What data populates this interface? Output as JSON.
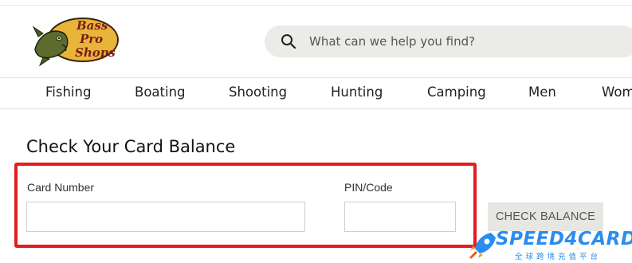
{
  "logo": {
    "text_line1": "Bass",
    "text_line2": "Pro",
    "text_line3": "Shops",
    "icon": "bass-fish-logo",
    "colors": {
      "oval": "#e9b43a",
      "text": "#7a1f16",
      "fish": "#5d6b2e"
    }
  },
  "search": {
    "placeholder": "What can we help you find?",
    "icon": "search-icon",
    "value": ""
  },
  "nav": {
    "items": [
      {
        "label": "Fishing"
      },
      {
        "label": "Boating"
      },
      {
        "label": "Shooting"
      },
      {
        "label": "Hunting"
      },
      {
        "label": "Camping"
      },
      {
        "label": "Men"
      },
      {
        "label": "Wom"
      }
    ]
  },
  "page": {
    "title": "Check Your Card Balance"
  },
  "form": {
    "card_number_label": "Card Number",
    "card_number_value": "",
    "pin_label": "PIN/Code",
    "pin_value": "",
    "submit_label": "CHECK BALANCE"
  },
  "annotation": {
    "highlight_color": "#e11e1e"
  },
  "watermark": {
    "text": "SPEED4CARD",
    "subtitle": "全球跨境充值平台",
    "color": "#2a8df0",
    "icon": "rocket-icon"
  }
}
